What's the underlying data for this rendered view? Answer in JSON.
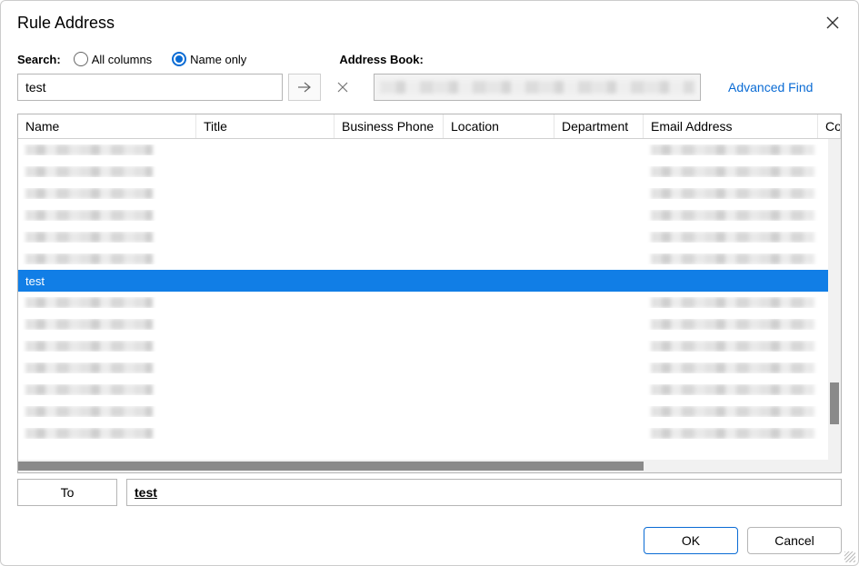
{
  "title": "Rule Address",
  "search": {
    "label": "Search:",
    "options": {
      "all": "All columns",
      "name_only": "Name only"
    },
    "selected": "name_only",
    "value": "test"
  },
  "address_book": {
    "label": "Address Book:"
  },
  "advanced_find": "Advanced Find",
  "columns": [
    "Name",
    "Title",
    "Business Phone",
    "Location",
    "Department",
    "Email Address",
    "Co"
  ],
  "selected_row": {
    "name": "test"
  },
  "blurred_rows_before": 6,
  "blurred_rows_after": 7,
  "to": {
    "button": "To",
    "value": "test"
  },
  "buttons": {
    "ok": "OK",
    "cancel": "Cancel"
  }
}
